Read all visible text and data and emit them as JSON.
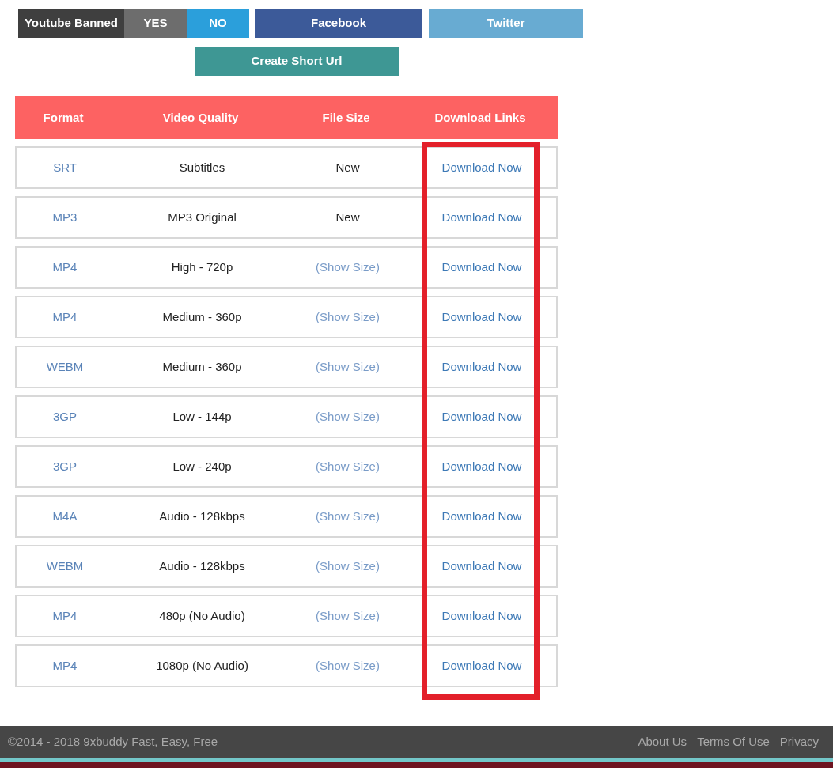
{
  "toggle": {
    "label": "Youtube Banned",
    "options": [
      {
        "label": "YES",
        "selected": false
      },
      {
        "label": "NO",
        "selected": true
      }
    ]
  },
  "share_buttons": [
    {
      "label": "Facebook",
      "kind": "facebook"
    },
    {
      "label": "Twitter",
      "kind": "twitter"
    }
  ],
  "short_url_button": "Create Short Url",
  "table": {
    "columns": [
      "Format",
      "Video Quality",
      "File Size",
      "Download Links"
    ],
    "rows": [
      {
        "format": "SRT",
        "quality": "Subtitles",
        "size": {
          "text": "New",
          "kind": "text"
        },
        "link": "Download Now"
      },
      {
        "format": "MP3",
        "quality": "MP3 Original",
        "size": {
          "text": "New",
          "kind": "text"
        },
        "link": "Download Now"
      },
      {
        "format": "MP4",
        "quality": "High - 720p",
        "size": {
          "text": "(Show Size)",
          "kind": "link"
        },
        "link": "Download Now"
      },
      {
        "format": "MP4",
        "quality": "Medium - 360p",
        "size": {
          "text": "(Show Size)",
          "kind": "link"
        },
        "link": "Download Now"
      },
      {
        "format": "WEBM",
        "quality": "Medium - 360p",
        "size": {
          "text": "(Show Size)",
          "kind": "link"
        },
        "link": "Download Now"
      },
      {
        "format": "3GP",
        "quality": "Low - 144p",
        "size": {
          "text": "(Show Size)",
          "kind": "link"
        },
        "link": "Download Now"
      },
      {
        "format": "3GP",
        "quality": "Low - 240p",
        "size": {
          "text": "(Show Size)",
          "kind": "link"
        },
        "link": "Download Now"
      },
      {
        "format": "M4A",
        "quality": "Audio - 128kbps",
        "size": {
          "text": "(Show Size)",
          "kind": "link"
        },
        "link": "Download Now"
      },
      {
        "format": "WEBM",
        "quality": "Audio - 128kbps",
        "size": {
          "text": "(Show Size)",
          "kind": "link"
        },
        "link": "Download Now"
      },
      {
        "format": "MP4",
        "quality": "480p (No Audio)",
        "size": {
          "text": "(Show Size)",
          "kind": "link"
        },
        "link": "Download Now"
      },
      {
        "format": "MP4",
        "quality": "1080p (No Audio)",
        "size": {
          "text": "(Show Size)",
          "kind": "link"
        },
        "link": "Download Now"
      }
    ]
  },
  "footer": {
    "copyright": "©2014 - 2018 9xbuddy Fast, Easy, Free",
    "links": [
      "About Us",
      "Terms Of Use",
      "Privacy"
    ]
  }
}
